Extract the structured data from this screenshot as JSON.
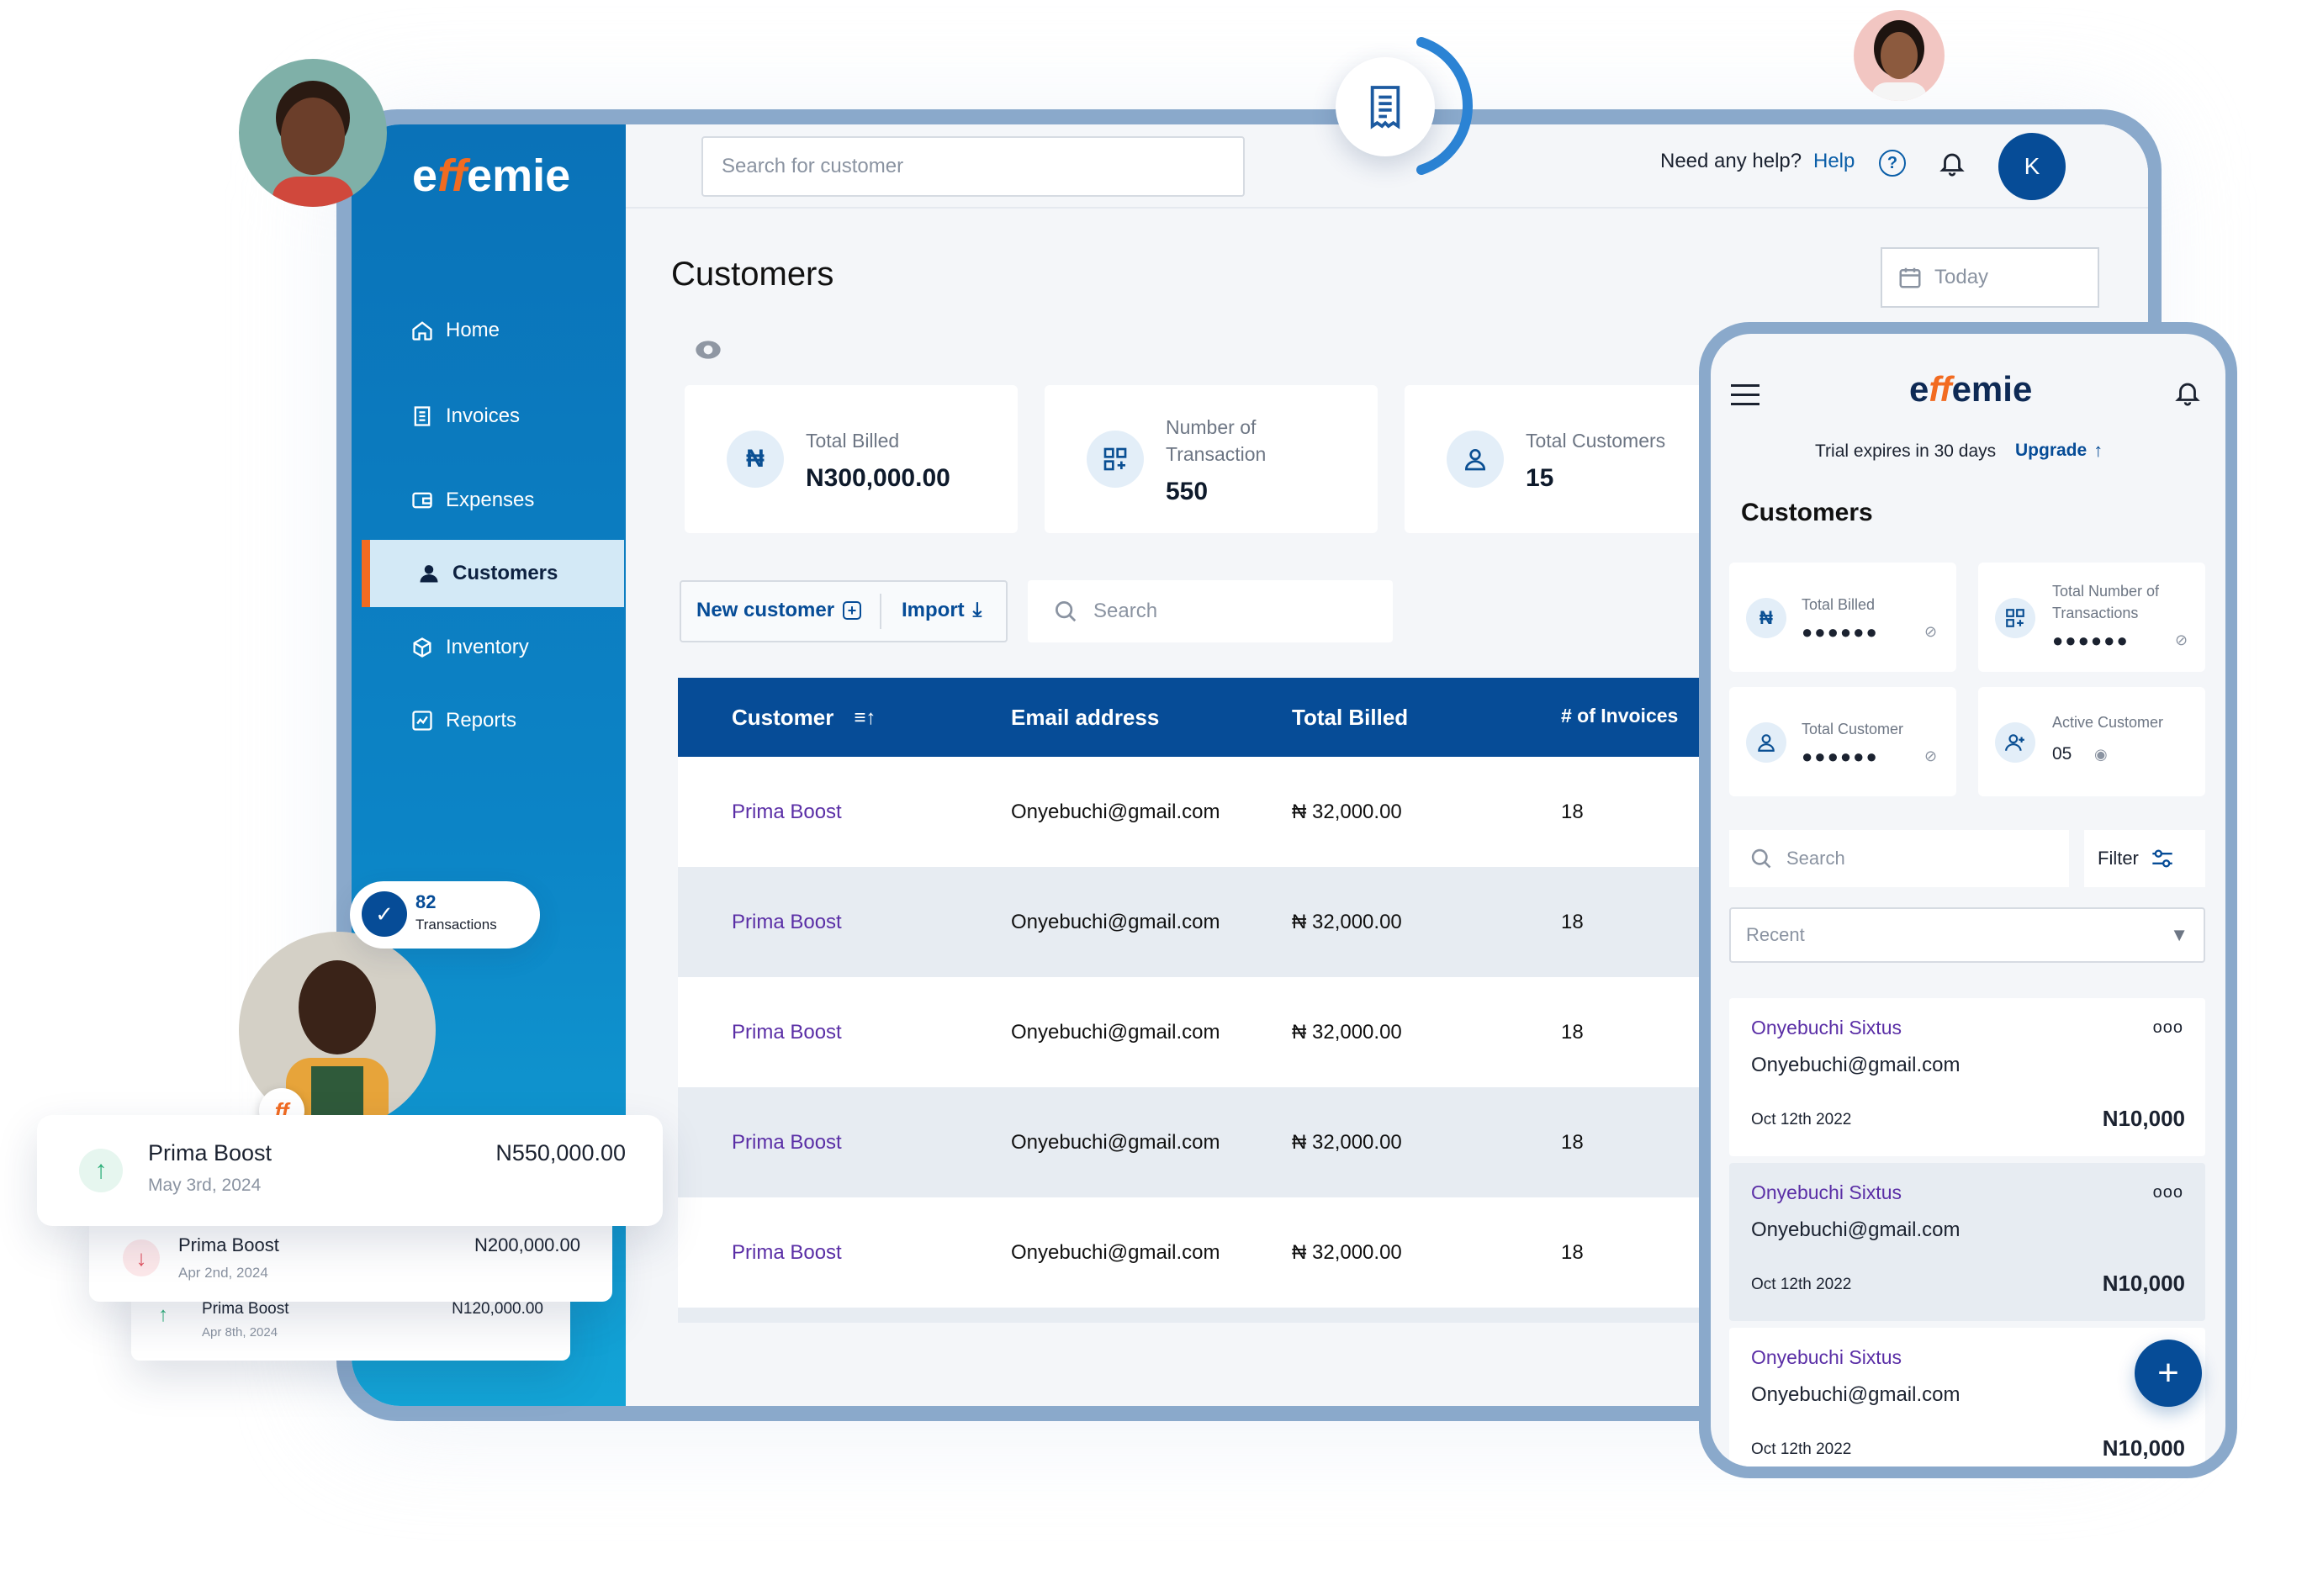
{
  "brand": {
    "name_prefix": "e",
    "name_ff": "ff",
    "name_suffix": "emie",
    "accent": "#f26b21",
    "primary": "#064c97",
    "sidebar": "#0a72b8"
  },
  "sidebar": {
    "items": [
      {
        "label": "Home",
        "icon": "home-icon"
      },
      {
        "label": "Invoices",
        "icon": "invoice-icon"
      },
      {
        "label": "Expenses",
        "icon": "wallet-icon"
      },
      {
        "label": "Customers",
        "icon": "person-icon",
        "active": true
      },
      {
        "label": "Inventory",
        "icon": "box-icon"
      },
      {
        "label": "Reports",
        "icon": "chart-icon"
      }
    ]
  },
  "header": {
    "search_placeholder": "Search for customer",
    "help_question": "Need any help?",
    "help_link": "Help",
    "user_initial": "K"
  },
  "page": {
    "title": "Customers",
    "date_filter": "Today"
  },
  "stats": [
    {
      "label": "Total Billed",
      "value": "N300,000.00",
      "icon_glyph": "₦"
    },
    {
      "label": "Number of Transaction",
      "label_line1": "Number of",
      "label_line2": "Transaction",
      "value": "550"
    },
    {
      "label": "Total Customers",
      "value": "15"
    }
  ],
  "toolbar": {
    "new_customer": "New customer",
    "import": "Import",
    "search_placeholder": "Search"
  },
  "table": {
    "columns": [
      "Customer",
      "Email address",
      "Total Billed",
      "# of Invoices"
    ],
    "rows": [
      {
        "customer": "Prima Boost",
        "email": "Onyebuchi@gmail.com",
        "billed": "₦ 32,000.00",
        "invoices": "18"
      },
      {
        "customer": "Prima Boost",
        "email": "Onyebuchi@gmail.com",
        "billed": "₦ 32,000.00",
        "invoices": "18"
      },
      {
        "customer": "Prima Boost",
        "email": "Onyebuchi@gmail.com",
        "billed": "₦ 32,000.00",
        "invoices": "18"
      },
      {
        "customer": "Prima Boost",
        "email": "Onyebuchi@gmail.com",
        "billed": "₦ 32,000.00",
        "invoices": "18"
      },
      {
        "customer": "Prima Boost",
        "email": "Onyebuchi@gmail.com",
        "billed": "₦ 32,000.00",
        "invoices": "18"
      }
    ]
  },
  "transactions_badge": {
    "count": "82",
    "label": "Transactions"
  },
  "float_transactions": [
    {
      "name": "Prima Boost",
      "date": "May 3rd, 2024",
      "amount": "N550,000.00",
      "direction": "up"
    },
    {
      "name": "Prima Boost",
      "date": "Apr 2nd, 2024",
      "amount": "N200,000.00",
      "direction": "down"
    },
    {
      "name": "Prima Boost",
      "date": "Apr 8th, 2024",
      "amount": "N120,000.00",
      "direction": "up"
    }
  ],
  "mobile": {
    "trial_text": "Trial expires in 30 days",
    "upgrade": "Upgrade",
    "title": "Customers",
    "stats": [
      {
        "label": "Total Billed",
        "value": "●●●●●●"
      },
      {
        "label": "Total Number of Transactions",
        "label_line1": "Total Number of",
        "label_line2": "Transactions",
        "value": "●●●●●●"
      },
      {
        "label": "Total Customer",
        "value": "●●●●●●"
      },
      {
        "label": "Active Customer",
        "value": "05"
      }
    ],
    "search_placeholder": "Search",
    "filter": "Filter",
    "sort_select": "Recent",
    "list": [
      {
        "name": "Onyebuchi Sixtus",
        "email": "Onyebuchi@gmail.com",
        "date": "Oct 12th 2022",
        "amount": "N10,000"
      },
      {
        "name": "Onyebuchi Sixtus",
        "email": "Onyebuchi@gmail.com",
        "date": "Oct 12th 2022",
        "amount": "N10,000"
      },
      {
        "name": "Onyebuchi Sixtus",
        "email": "Onyebuchi@gmail.com",
        "date": "Oct 12th 2022",
        "amount": "N10,000"
      }
    ]
  }
}
